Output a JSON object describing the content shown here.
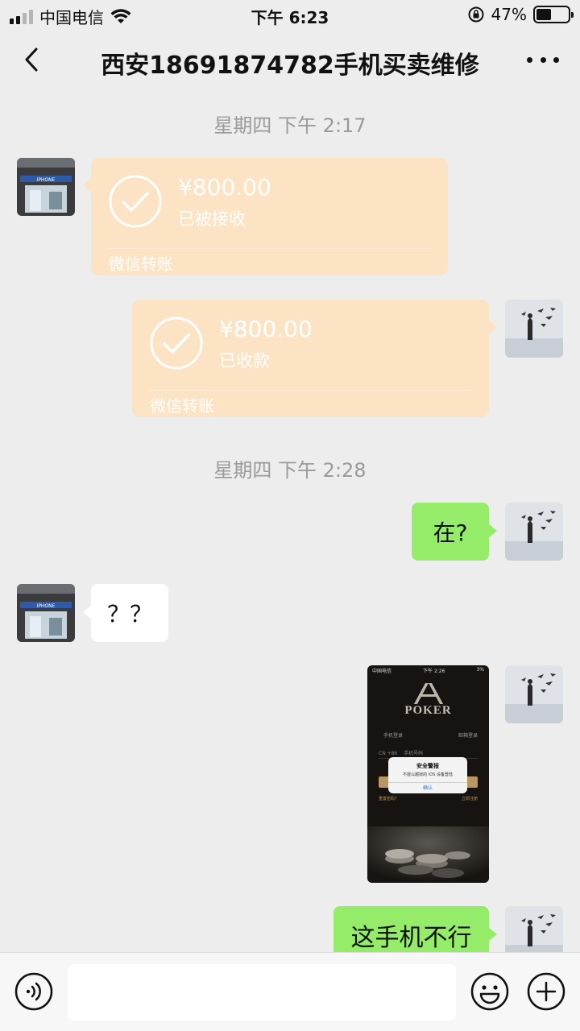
{
  "status_bar": {
    "carrier": "中国电信",
    "time": "下午 6:23",
    "battery": "47%",
    "battery_level": 0.47
  },
  "nav": {
    "title": "西安18691874782手机买卖维修"
  },
  "messages": {
    "ts1": "星期四 下午 2:17",
    "transfer_in": {
      "amount": "¥800.00",
      "status": "已被接收",
      "source": "微信转账"
    },
    "transfer_out": {
      "amount": "¥800.00",
      "status": "已收款",
      "source": "微信转账"
    },
    "ts2": "星期四 下午 2:28",
    "msg_here": "在?",
    "msg_question": "？？",
    "screenshot": {
      "carrier": "中国电信",
      "time": "下午 2:26",
      "battery": "3%",
      "brand": "POKER",
      "tab_phone": "手机登录",
      "tab_email": "邮箱登录",
      "country_code": "CN +86",
      "phone_placeholder": "手机号码",
      "alert_title": "安全警报",
      "alert_message": "不能以越狱的 iOS 设备登陆",
      "alert_button": "确认",
      "forgot": "重置密码?",
      "register": "立即注册"
    },
    "msg_phone_bad": "这手机不行"
  },
  "input_bar": {
    "placeholder": ""
  },
  "colors": {
    "background": "#ededed",
    "transfer": "#fbe3c4",
    "sent_bubble": "#95ec69",
    "received_bubble": "#ffffff"
  }
}
